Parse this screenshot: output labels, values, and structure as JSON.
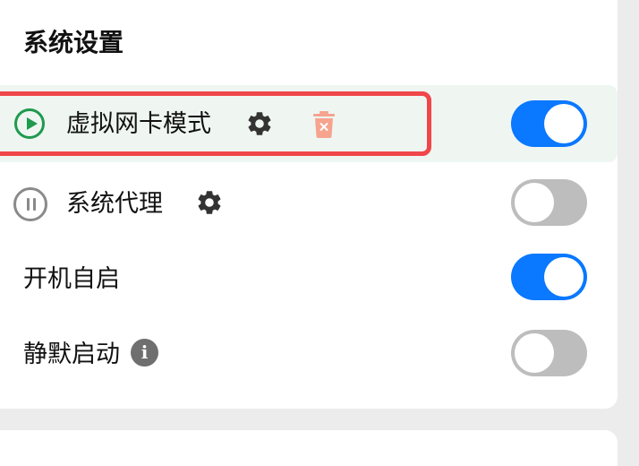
{
  "section": {
    "title": "系统设置"
  },
  "rows": [
    {
      "label": "虚拟网卡模式",
      "status_icon": "play-circle-icon",
      "has_gear": true,
      "has_delete": true,
      "toggle_on": true,
      "highlighted": true
    },
    {
      "label": "系统代理",
      "status_icon": "pause-circle-icon",
      "has_gear": true,
      "toggle_on": false
    },
    {
      "label": "开机自启",
      "toggle_on": true
    },
    {
      "label": "静默启动",
      "has_info": true,
      "info_glyph": "i",
      "toggle_on": false
    }
  ],
  "colors": {
    "accent_blue": "#0a78ff",
    "toggle_off": "#bdbdbd",
    "play_green": "#1f9a4e",
    "highlight_bg": "#eff6f2",
    "annotation_red": "#f0474a",
    "delete_salmon": "#f6a48e",
    "gear_dark": "#333333"
  }
}
